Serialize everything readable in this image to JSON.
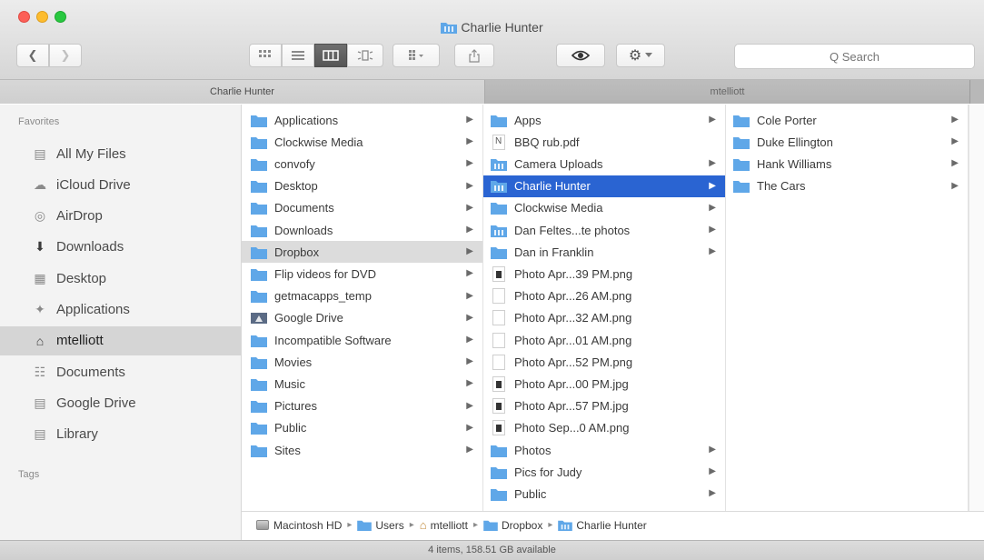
{
  "window": {
    "title": "Charlie Hunter"
  },
  "toolbar": {
    "back_icon": "chevron-left-icon",
    "forward_icon": "chevron-right-icon",
    "view_modes": [
      "icon-view-icon",
      "list-view-icon",
      "column-view-icon",
      "cover-flow-icon"
    ],
    "active_view": "column",
    "arrange_icon": "arrange-icon",
    "share_icon": "share-icon",
    "quicklook_icon": "eye-icon",
    "action_icon": "gear-icon",
    "search_placeholder": "Q Search"
  },
  "tabs": [
    {
      "label": "Charlie Hunter",
      "active": true
    },
    {
      "label": "mtelliott",
      "active": false
    }
  ],
  "sidebar": {
    "favorites_header": "Favorites",
    "items": [
      {
        "label": "All My Files",
        "icon": "all-files-icon"
      },
      {
        "label": "iCloud Drive",
        "icon": "cloud-icon"
      },
      {
        "label": "AirDrop",
        "icon": "airdrop-icon"
      },
      {
        "label": "Downloads",
        "icon": "downloads-icon"
      },
      {
        "label": "Desktop",
        "icon": "desktop-icon"
      },
      {
        "label": "Applications",
        "icon": "applications-icon"
      },
      {
        "label": "mtelliott",
        "icon": "home-icon",
        "selected": true
      },
      {
        "label": "Documents",
        "icon": "documents-icon"
      },
      {
        "label": "Google Drive",
        "icon": "folder-icon"
      },
      {
        "label": "Library",
        "icon": "folder-icon"
      }
    ],
    "tags_header": "Tags"
  },
  "columns": {
    "col1": [
      {
        "label": "Applications",
        "kind": "folder"
      },
      {
        "label": "Clockwise Media",
        "kind": "folder"
      },
      {
        "label": "convofy",
        "kind": "folder"
      },
      {
        "label": "Desktop",
        "kind": "folder"
      },
      {
        "label": "Documents",
        "kind": "folder"
      },
      {
        "label": "Downloads",
        "kind": "folder"
      },
      {
        "label": "Dropbox",
        "kind": "folder",
        "state": "path"
      },
      {
        "label": "Flip videos for DVD",
        "kind": "folder"
      },
      {
        "label": "getmacapps_temp",
        "kind": "folder"
      },
      {
        "label": "Google Drive",
        "kind": "gdrive"
      },
      {
        "label": "Incompatible Software",
        "kind": "folder"
      },
      {
        "label": "Movies",
        "kind": "folder"
      },
      {
        "label": "Music",
        "kind": "folder"
      },
      {
        "label": "Pictures",
        "kind": "folder"
      },
      {
        "label": "Public",
        "kind": "folder"
      },
      {
        "label": "Sites",
        "kind": "folder"
      }
    ],
    "col2": [
      {
        "label": "Apps",
        "kind": "folder"
      },
      {
        "label": "BBQ rub.pdf",
        "kind": "pdf"
      },
      {
        "label": "Camera Uploads",
        "kind": "shared"
      },
      {
        "label": "Charlie Hunter",
        "kind": "shared",
        "state": "selected"
      },
      {
        "label": "Clockwise Media",
        "kind": "folder"
      },
      {
        "label": "Dan Feltes...te photos",
        "kind": "shared"
      },
      {
        "label": "Dan in Franklin",
        "kind": "folder"
      },
      {
        "label": "Photo Apr...39 PM.png",
        "kind": "image-dark"
      },
      {
        "label": "Photo Apr...26 AM.png",
        "kind": "image"
      },
      {
        "label": "Photo Apr...32 AM.png",
        "kind": "image"
      },
      {
        "label": "Photo Apr...01 AM.png",
        "kind": "image"
      },
      {
        "label": "Photo Apr...52 PM.png",
        "kind": "image"
      },
      {
        "label": "Photo Apr...00 PM.jpg",
        "kind": "image-dark"
      },
      {
        "label": "Photo Apr...57 PM.jpg",
        "kind": "image-dark"
      },
      {
        "label": "Photo Sep...0 AM.png",
        "kind": "image-dark"
      },
      {
        "label": "Photos",
        "kind": "folder"
      },
      {
        "label": "Pics for Judy",
        "kind": "folder"
      },
      {
        "label": "Public",
        "kind": "folder"
      }
    ],
    "col3": [
      {
        "label": "Cole Porter",
        "kind": "folder"
      },
      {
        "label": "Duke Ellington",
        "kind": "folder"
      },
      {
        "label": "Hank Williams",
        "kind": "folder"
      },
      {
        "label": "The Cars",
        "kind": "folder"
      }
    ]
  },
  "pathbar": [
    {
      "label": "Macintosh HD",
      "icon": "hard-drive-icon"
    },
    {
      "label": "Users",
      "icon": "folder-icon"
    },
    {
      "label": "mtelliott",
      "icon": "home-icon"
    },
    {
      "label": "Dropbox",
      "icon": "folder-icon"
    },
    {
      "label": "Charlie Hunter",
      "icon": "shared-folder-icon"
    }
  ],
  "status": "4 items, 158.51 GB available",
  "colors": {
    "selection": "#2a64d2",
    "folder": "#5fa7e8",
    "path_highlight": "#dcdcdc"
  }
}
